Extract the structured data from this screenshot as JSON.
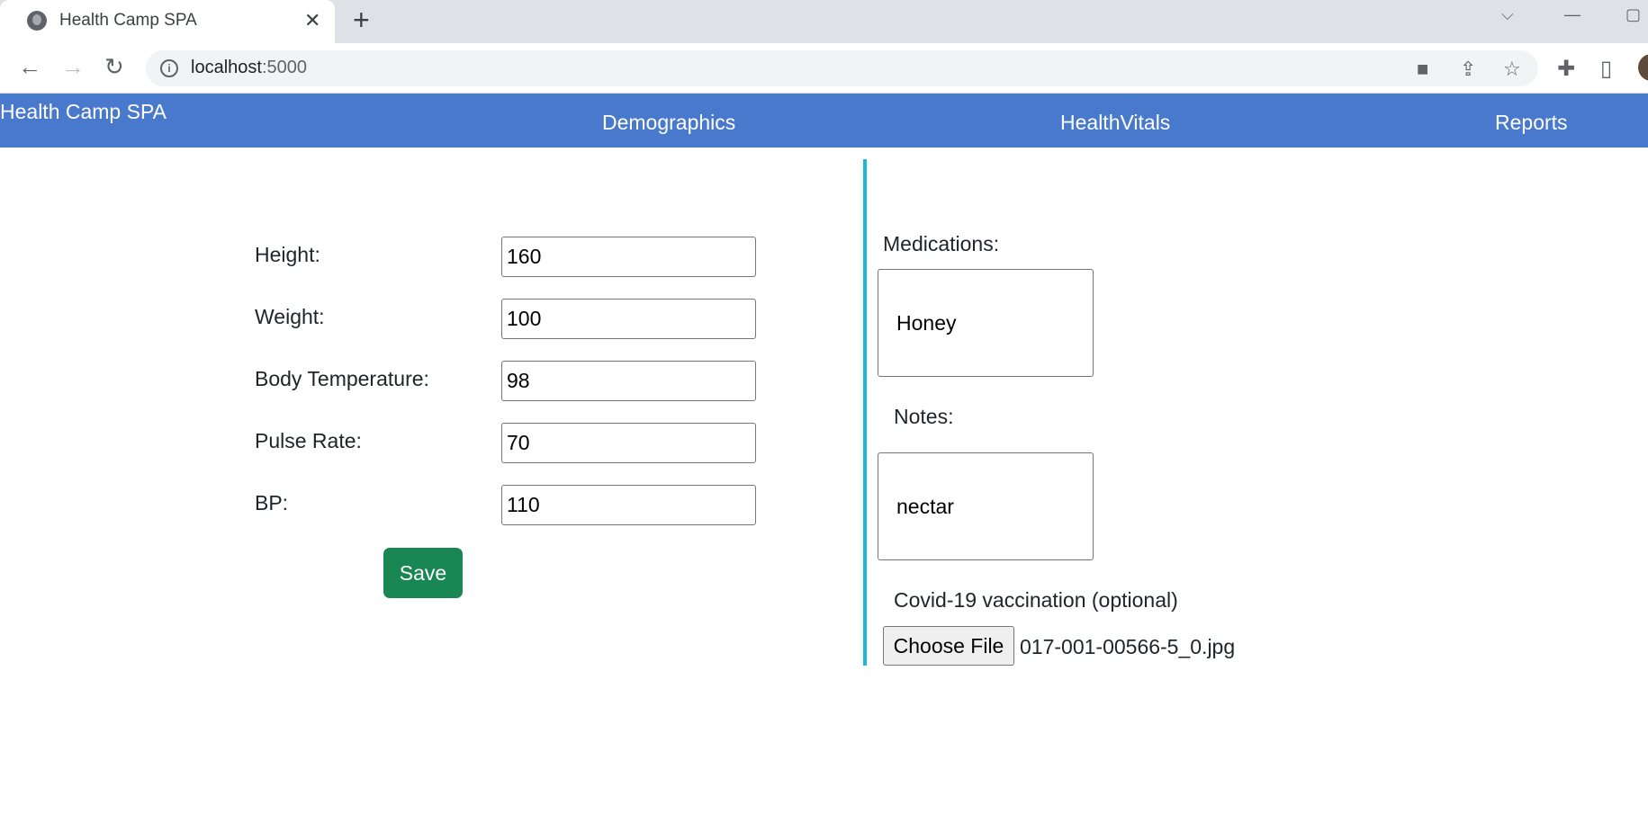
{
  "browser": {
    "tab_title": "Health Camp SPA",
    "tab_close": "✕",
    "new_tab": "+",
    "url_host": "localhost",
    "url_port": ":5000"
  },
  "app": {
    "brand": "Health Camp SPA",
    "nav": [
      "Demographics",
      "HealthVitals",
      "Reports"
    ],
    "accent_color": "#4879cc"
  },
  "vitals": [
    {
      "label": "Height:",
      "value": "160"
    },
    {
      "label": "Weight:",
      "value": "100"
    },
    {
      "label": "Body Temperature:",
      "value": "98"
    },
    {
      "label": "Pulse Rate:",
      "value": "70"
    },
    {
      "label": "BP:",
      "value": "110"
    }
  ],
  "save_label": "Save",
  "side": {
    "medications_label": "Medications:",
    "medications_value": "Honey",
    "notes_label": "Notes:",
    "notes_value": "nectar",
    "vaccination_label": "Covid-19 vaccination (optional)",
    "choose_file_label": "Choose File",
    "file_name": "017-001-00566-5_0.jpg"
  }
}
